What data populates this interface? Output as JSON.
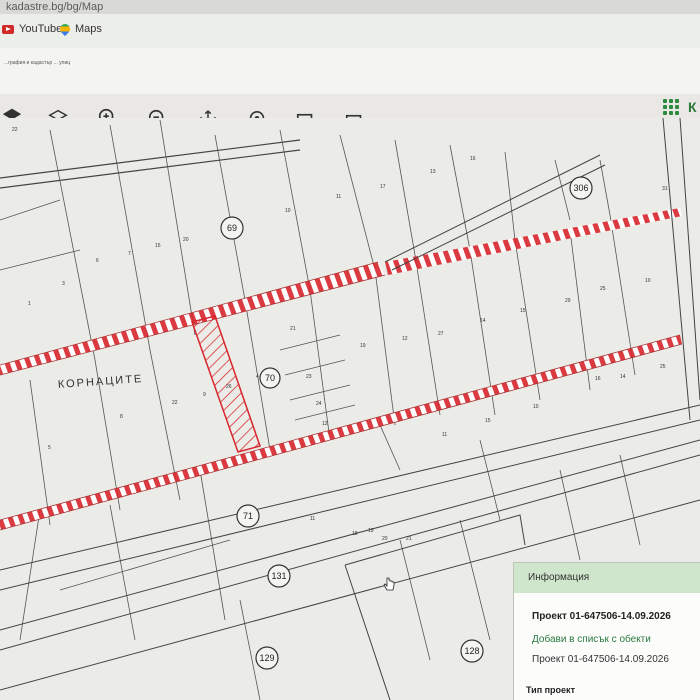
{
  "browser": {
    "url": "kadastre.bg/bg/Map",
    "bookmarks": [
      {
        "label": "YouTube",
        "icon": "youtube-icon"
      },
      {
        "label": "Maps",
        "icon": "maps-pin-icon"
      }
    ]
  },
  "header": {
    "subtitle": "...графия и кадастър ... улиц"
  },
  "toolbar": {
    "tools": [
      {
        "name": "base-layers-icon"
      },
      {
        "name": "layers-icon"
      },
      {
        "name": "zoom-in-icon"
      },
      {
        "name": "zoom-out-icon"
      },
      {
        "name": "pan-icon"
      },
      {
        "name": "location-pin-icon"
      },
      {
        "name": "select-rectangle-icon"
      },
      {
        "name": "deselect-rectangle-icon"
      },
      {
        "name": "info-icon",
        "active": true
      },
      {
        "name": "measure-length-icon"
      },
      {
        "name": "measure-area-icon"
      },
      {
        "name": "map-icon"
      },
      {
        "name": "coordinates-icon"
      },
      {
        "name": "document-icon"
      },
      {
        "name": "print-icon"
      }
    ],
    "accent_color": "#1f8d3e"
  },
  "map": {
    "region_name": "КОРНАЦИТЕ",
    "block_numbers": [
      "69",
      "70",
      "71",
      "306",
      "131",
      "128",
      "129"
    ],
    "parcel_numbers": [
      "22",
      "17",
      "16",
      "10",
      "11",
      "13",
      "7",
      "15",
      "20",
      "6",
      "3",
      "1",
      "26",
      "21",
      "19",
      "12",
      "27",
      "14",
      "15",
      "29",
      "25",
      "9",
      "4",
      "5",
      "8",
      "22",
      "23",
      "24",
      "12",
      "10",
      "11",
      "15",
      "16",
      "14",
      "25",
      "10",
      "11",
      "18",
      "19",
      "20",
      "21",
      "31"
    ]
  },
  "info_panel": {
    "header": "Информация",
    "title": "Проект 01-647506-14.09.2026",
    "add_link": "Добави в списък с обекти",
    "project_text": "Проект 01-647506-14.09.2026",
    "type_heading": "Тип проект",
    "cut_text": "Проект 01-647506-14.09.2026"
  }
}
